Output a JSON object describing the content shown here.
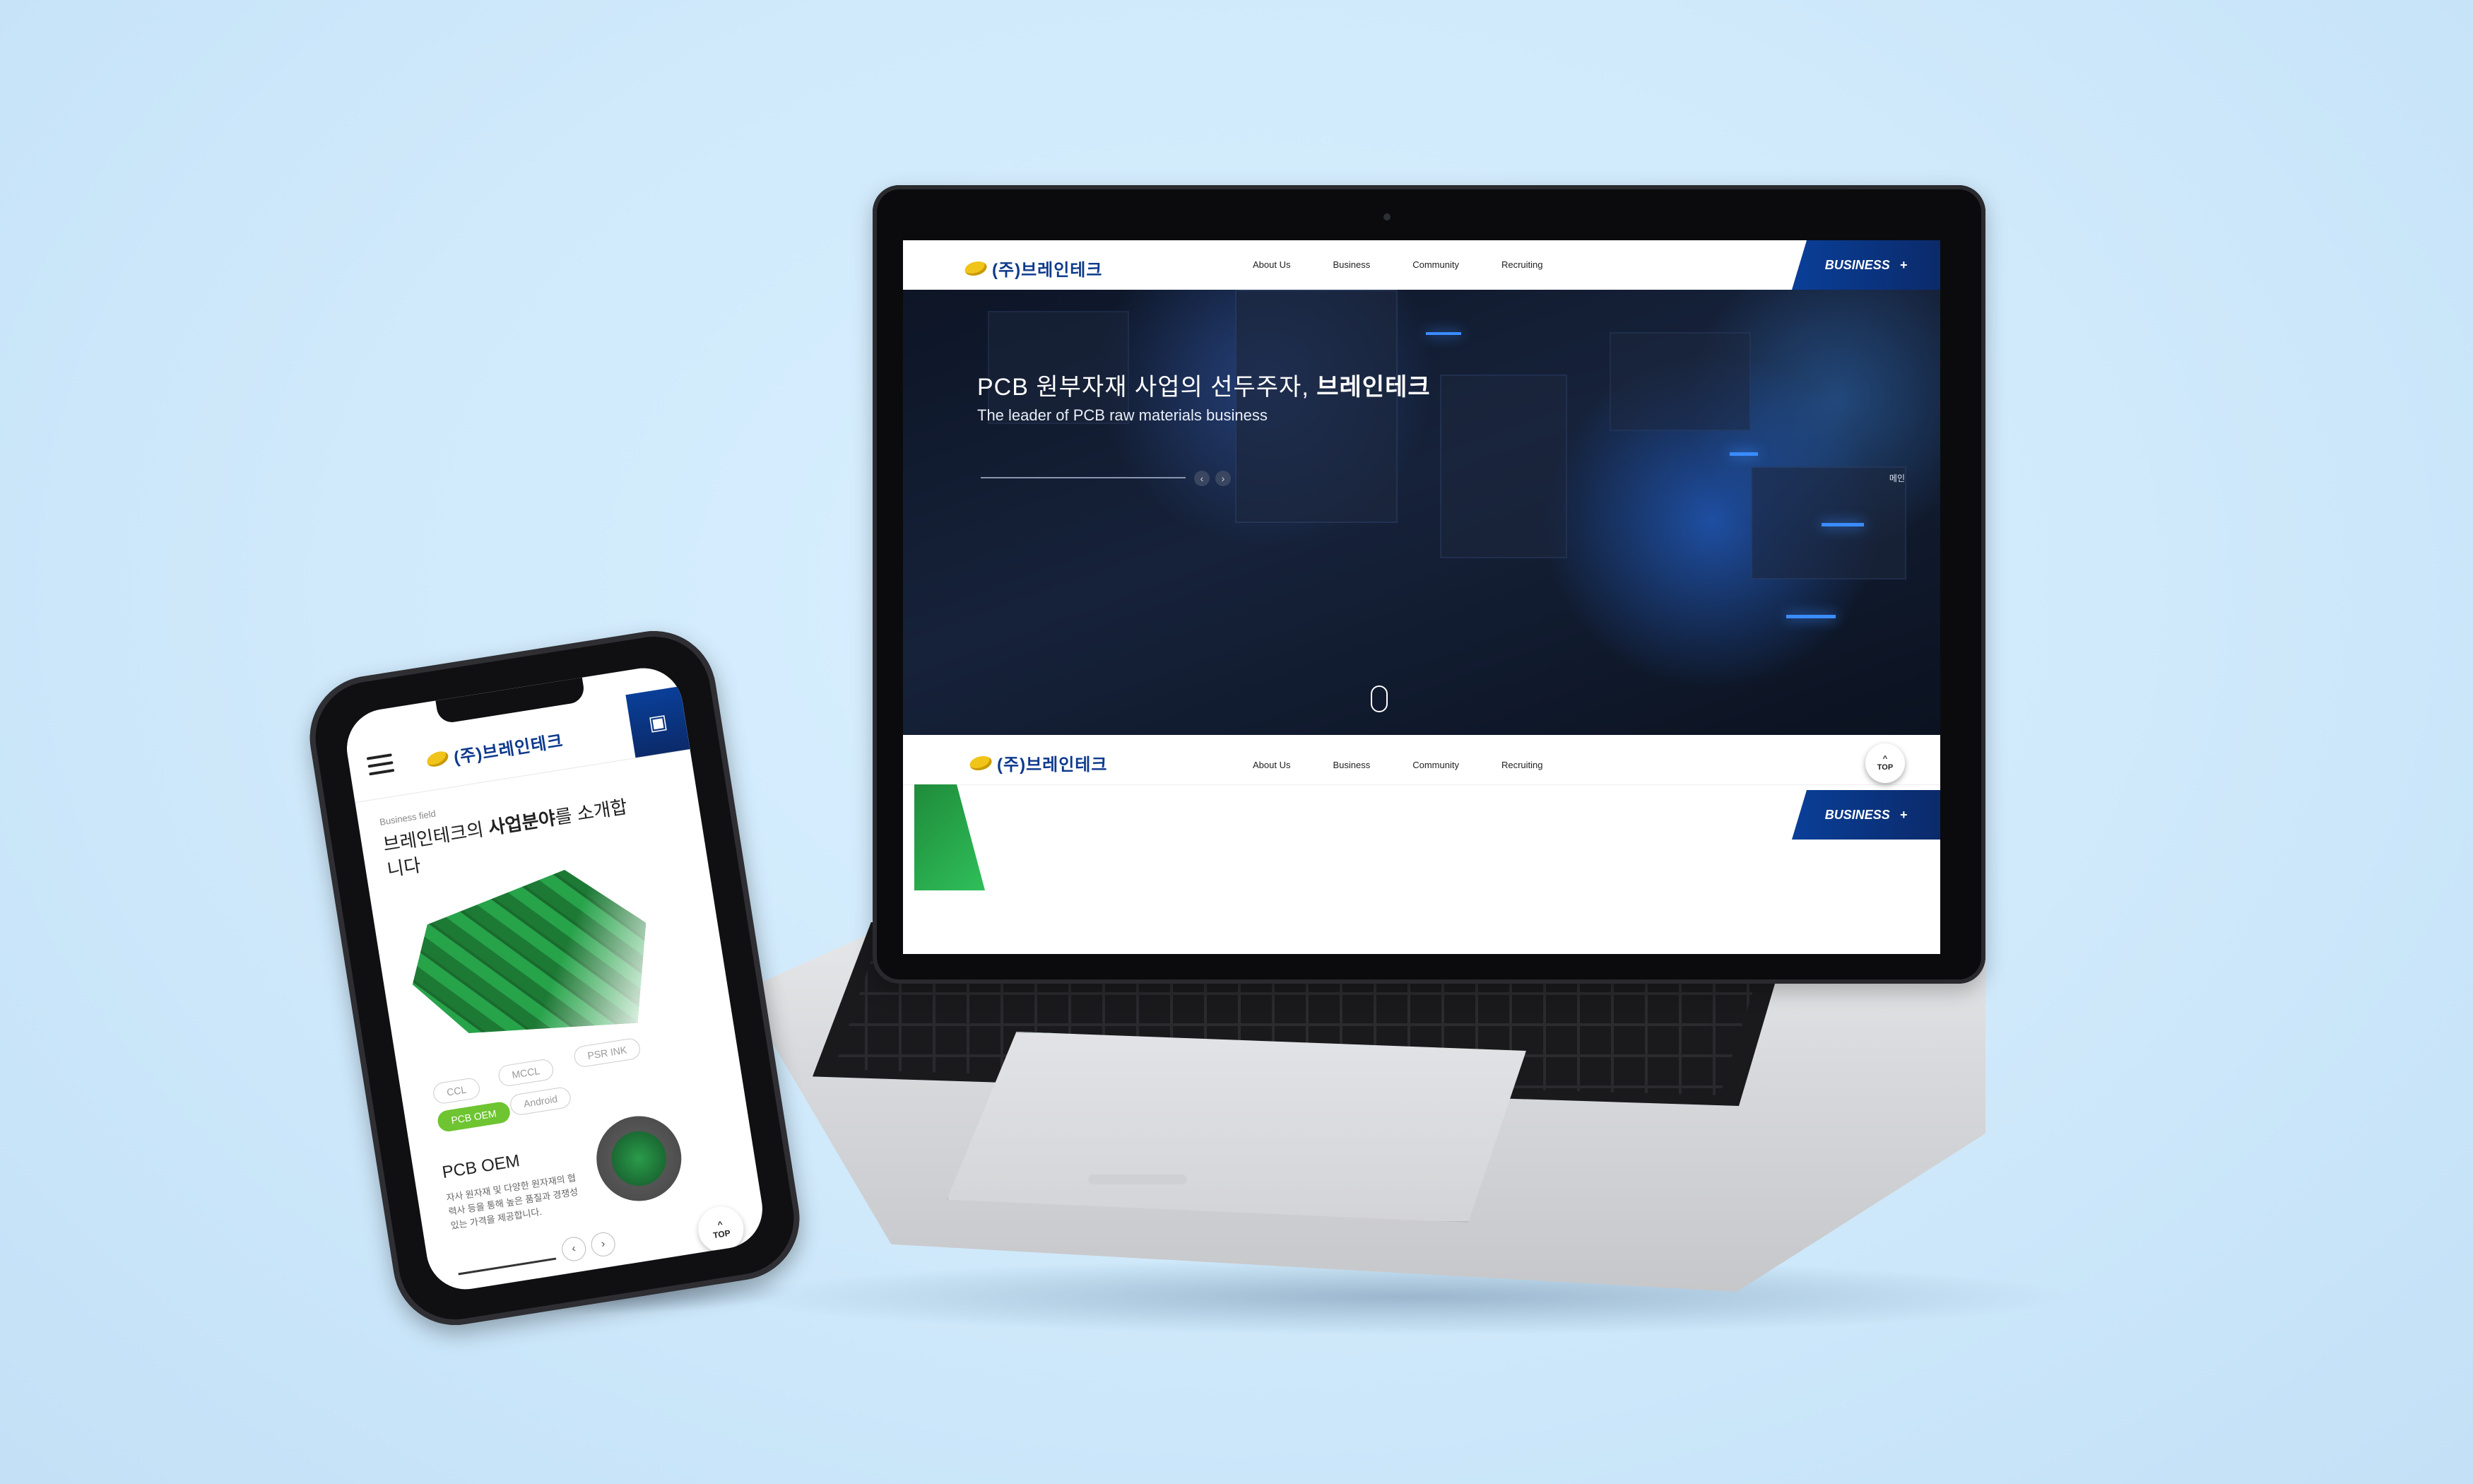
{
  "laptop": {
    "header": {
      "logo_text": "(주)브레인테크",
      "nav": [
        "About Us",
        "Business",
        "Community",
        "Recruiting"
      ],
      "business_button": "BUSINESS",
      "business_plus": "+"
    },
    "hero": {
      "title_prefix": "PCB 원부자재 사업의 선두주자, ",
      "title_brand": "브레인테크",
      "subtitle": "The leader of PCB raw materials business",
      "right_label": "메인",
      "arrow_prev": "‹",
      "arrow_next": "›"
    },
    "top_button": "TOP",
    "second_header": {
      "logo_text": "(주)브레인테크",
      "nav": [
        "About Us",
        "Business",
        "Community",
        "Recruiting"
      ],
      "business_button": "BUSINESS",
      "business_plus": "+"
    }
  },
  "phone": {
    "logo_text": "(주)브레인테크",
    "field_label": "Business field",
    "heading_prefix": "브레인테크의 ",
    "heading_bold": "사업분야",
    "heading_suffix": "를 소개합니다",
    "chips": [
      "CCL",
      "MCCL",
      "PSR INK",
      "PCB OEM",
      "Android"
    ],
    "oem_title": "PCB OEM",
    "oem_desc": "자사 원자재 및 다양한 원자재의 협력사 등을 통해 높은 품질과 경쟁성있는 가격을 제공합니다.",
    "arrow_prev": "‹",
    "arrow_next": "›",
    "top_button": "TOP"
  },
  "colors": {
    "background": "#d4ecfd",
    "brand_blue": "#0e3a8c",
    "business_button": "#0a3f99",
    "logo_yellow": "#f0c419",
    "chip_active": "#6ec431"
  }
}
